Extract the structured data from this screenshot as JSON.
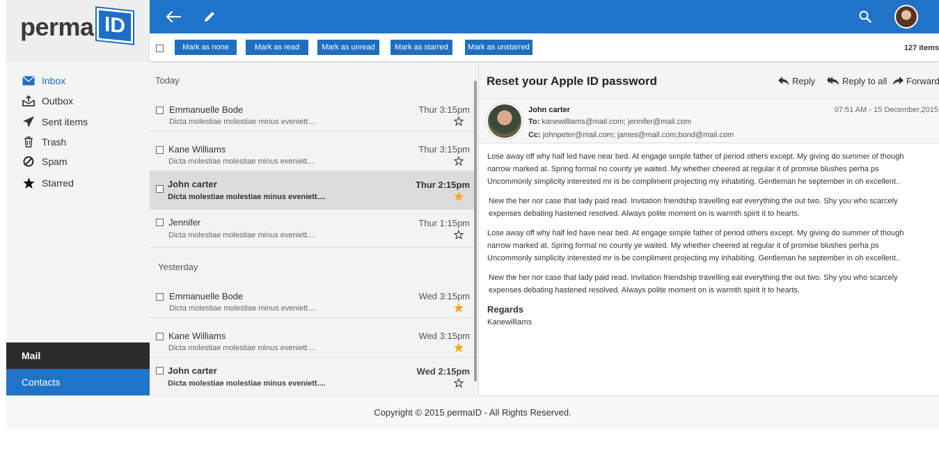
{
  "logo": {
    "word": "perma",
    "badge": "ID"
  },
  "header": {
    "back_icon": "arrow-left-icon",
    "compose_icon": "pencil-icon",
    "search_icon": "search-icon",
    "avatar": "user-avatar"
  },
  "toolbar": {
    "buttons": [
      "Mark as  none",
      "Mark as read",
      "Mark as unread",
      "Mark as  starred",
      "Mark as  unstarred"
    ],
    "count": "127 items"
  },
  "sidebar": {
    "items": [
      {
        "label": "Inbox",
        "icon": "envelope-icon"
      },
      {
        "label": "Outbox",
        "icon": "outbox-icon"
      },
      {
        "label": "Sent items",
        "icon": "paper-plane-icon"
      },
      {
        "label": "Trash",
        "icon": "trash-icon"
      },
      {
        "label": "Spam",
        "icon": "ban-icon"
      },
      {
        "label": "Starred",
        "icon": "star-icon"
      }
    ],
    "tabs": [
      "Mail",
      "Contacts"
    ]
  },
  "list": {
    "groups": [
      "Today",
      "Yesterday"
    ],
    "rows": [
      {
        "sender": "Emmanuelle Bode",
        "preview": "Dicta molestiae molestiae minus eveniett....",
        "time": "Thur 3:15pm",
        "starred": false
      },
      {
        "sender": "Kane Williams",
        "preview": "Dicta molestiae molestiae minus eveniett....",
        "time": "Thur 3:15pm",
        "starred": false
      },
      {
        "sender": "John carter",
        "preview": "Dicta molestiae molestiae minus eveniett....",
        "time": "Thur 2:15pm",
        "starred": true
      },
      {
        "sender": "Jennifer",
        "preview": "Dicta molestiae molestiae minus eveniett....",
        "time": "Thur 1:15pm",
        "starred": false
      },
      {
        "sender": "Emmanuelle Bode",
        "preview": "Dicta molestiae molestiae minus eveniett....",
        "time": "Wed 3:15pm",
        "starred": true
      },
      {
        "sender": "Kane Williams",
        "preview": "Dicta molestiae molestiae minus eveniett....",
        "time": "Wed 3:15pm",
        "starred": true
      },
      {
        "sender": "John carter",
        "preview": "Dicta molestiae molestiae minus eveniett....",
        "time": "Wed 2:15pm",
        "starred": false
      }
    ]
  },
  "reader": {
    "subject": "Reset your Apple ID password",
    "actions": [
      "Reply",
      "Reply to all",
      "Forward"
    ],
    "from": "John carter",
    "date": "07:51 AM - 15 December,2015",
    "to_label": "To:",
    "to": "kanewilliams@mail.com; jennifer@mail.com",
    "cc_label": "Cc:",
    "cc": "johnpeter@mail.com; james@mail.com;bond@mail.com",
    "paragraphs": [
      "Lose away off why half led have near bed. At engage simple father of period others except. My giving do summer of though narrow marked at. Spring formal no county ye waited. My whether cheered at regular it of promise blushes perha ps Uncommonly simplicity interested mr is be compliment projecting my inhabiting. Gentleman he september in oh excellent..",
      "New the her nor case that lady paid read. Invitation friendship travelling eat everything the out two. Shy you who scarcely expenses debating hastened resolved. Always polite moment on is warmth spirit it to hearts.",
      "Lose away off why half led have near bed. At engage simple father of period others except. My giving do summer of though narrow marked at. Spring formal no county ye waited. My whether cheered at regular it of promise blushes perha ps Uncommonly simplicity interested mr is be compliment projecting my inhabiting. Gentleman he september in oh excellent..",
      "New the her nor case that lady paid read. Invitation friendship travelling eat everything the out two. Shy you who scarcely expenses debating hastened resolved. Always polite moment on is warmth spirit it to hearts."
    ],
    "regards": "Regards",
    "signature": "Kanewilliams"
  },
  "footer": {
    "text": "Copyright © 2015 permaID  -  All Rights Reserved."
  },
  "colors": {
    "brand": "#1f73c9",
    "dark_tab": "#2b2b2b",
    "star": "#f5a623"
  }
}
